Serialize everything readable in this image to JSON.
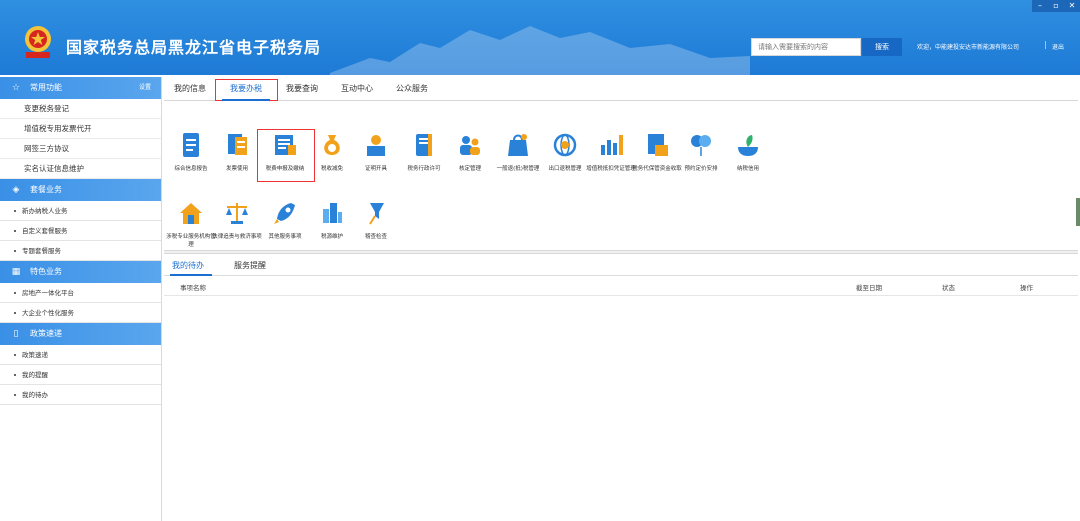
{
  "window": {
    "minimize": "–",
    "restore": "▫",
    "close": "✕"
  },
  "header": {
    "title": "国家税务总局黑龙江省电子税务局",
    "search_placeholder": "请输入需要搜索的内容",
    "search_button": "搜索",
    "welcome": "欢迎，中能建投安达市新能源有限公司",
    "separator": "|",
    "logout": "退出"
  },
  "sidebar": {
    "common": {
      "title": "常用功能",
      "setting": "设置",
      "items": [
        "变更税务登记",
        "增值税专用发票代开",
        "网签三方协议",
        "实名认证信息维护"
      ]
    },
    "package": {
      "title": "套餐业务",
      "items": [
        "新办纳税人业务",
        "自定义套餐服务",
        "专题套餐服务"
      ]
    },
    "special": {
      "title": "特色业务",
      "items": [
        "房地产一体化平台",
        "大企业个性化服务"
      ]
    },
    "policy": {
      "title": "政策速递",
      "items": [
        "政策速递",
        "我的提醒",
        "我的待办"
      ]
    }
  },
  "main": {
    "tabs": [
      "我的信息",
      "我要办税",
      "我要查询",
      "互动中心",
      "公众服务"
    ],
    "active_tab": "我要办税",
    "services": [
      {
        "label": "综合信息报告",
        "icon": "report-doc-icon"
      },
      {
        "label": "发票使用",
        "icon": "invoice-icon"
      },
      {
        "label": "税费申报及缴纳",
        "icon": "tax-declare-icon"
      },
      {
        "label": "税收减免",
        "icon": "money-bag-icon"
      },
      {
        "label": "证明开具",
        "icon": "certificate-icon"
      },
      {
        "label": "税务行政许可",
        "icon": "notebook-icon"
      },
      {
        "label": "核定管理",
        "icon": "people-icon"
      },
      {
        "label": "一般退(抵)税管理",
        "icon": "refund-bag-icon"
      },
      {
        "label": "出口退税管理",
        "icon": "globe-icon"
      },
      {
        "label": "增值税抵扣凭证管理",
        "icon": "bar-chart-icon"
      },
      {
        "label": "税务代保管资金收取",
        "icon": "custody-icon"
      },
      {
        "label": "预约定价安排",
        "icon": "balloon-icon"
      },
      {
        "label": "纳税信用",
        "icon": "plant-icon"
      },
      {
        "label": "涉税专业服务机构管理",
        "icon": "house-icon"
      },
      {
        "label": "法律追责与救济事项",
        "icon": "scale-icon"
      },
      {
        "label": "其他服务事项",
        "icon": "rocket-icon"
      },
      {
        "label": "税源维护",
        "icon": "building-icon"
      },
      {
        "label": "稽查检查",
        "icon": "pin-icon"
      }
    ],
    "todo_tabs": [
      "我的待办",
      "服务提醒"
    ],
    "table_headers": {
      "name": "事项名称",
      "deadline": "截至日期",
      "status": "状态",
      "action": "操作"
    }
  },
  "colors": {
    "accent": "#1a6fd0",
    "header": "#2383dc",
    "highlight_border": "#e33333"
  }
}
